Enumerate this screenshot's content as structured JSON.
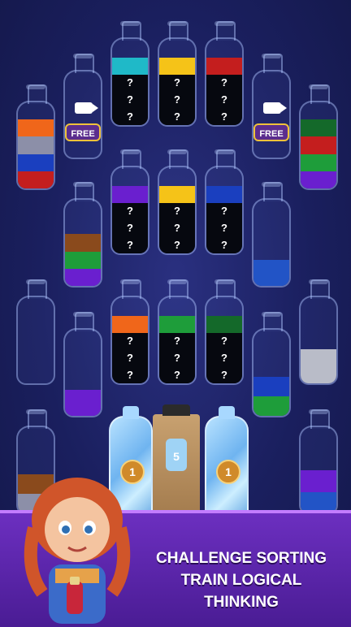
{
  "colors": {
    "cyan": "#1fb9c8",
    "yellow": "#f5c318",
    "red": "#c41e1e",
    "orange": "#f0661a",
    "gray": "#8c8fa8",
    "blue": "#1a3fbf",
    "green": "#1e9d3a",
    "dark_green": "#14692a",
    "purple": "#6a1fcf",
    "brown": "#8a4a1c",
    "light_gray": "#b9bcc8",
    "royal_blue": "#2254c6"
  },
  "bottles": [
    {
      "id": 1,
      "layers": [
        "orange",
        "gray",
        "blue",
        "red"
      ],
      "fill": 0.8
    },
    {
      "id": 2,
      "locked": true,
      "badge": "FREE",
      "icon": "video-camera-icon"
    },
    {
      "id": 3,
      "mystery": [
        "cyan"
      ],
      "unknown_count": 3
    },
    {
      "id": 4,
      "mystery": [
        "yellow"
      ],
      "unknown_count": 3
    },
    {
      "id": 5,
      "mystery": [
        "red"
      ],
      "unknown_count": 3
    },
    {
      "id": 6,
      "locked": true,
      "badge": "FREE",
      "icon": "video-camera-icon"
    },
    {
      "id": 7,
      "layers": [
        "dark_green",
        "red",
        "green",
        "purple"
      ],
      "fill": 0.8
    },
    {
      "id": 8,
      "layers": [
        "brown",
        "green",
        "purple"
      ],
      "fill": 0.6
    },
    {
      "id": 9,
      "mystery": [
        "purple"
      ],
      "unknown_count": 3
    },
    {
      "id": 10,
      "mystery": [
        "yellow"
      ],
      "unknown_count": 3
    },
    {
      "id": 11,
      "mystery": [
        "blue"
      ],
      "unknown_count": 3
    },
    {
      "id": 12,
      "layers": [
        "royal_blue"
      ],
      "fill": 0.3
    },
    {
      "id": 13,
      "layers": [],
      "fill": 0
    },
    {
      "id": 14,
      "layers": [
        "purple"
      ],
      "fill": 0.3
    },
    {
      "id": 15,
      "mystery": [
        "orange"
      ],
      "unknown_count": 3
    },
    {
      "id": 16,
      "mystery": [
        "green"
      ],
      "unknown_count": 3
    },
    {
      "id": 17,
      "mystery": [
        "dark_green"
      ],
      "unknown_count": 3
    },
    {
      "id": 18,
      "layers": [
        "blue",
        "green"
      ],
      "fill": 0.45
    },
    {
      "id": 19,
      "layers": [
        "light_gray"
      ],
      "fill": 0.4
    },
    {
      "id": 20,
      "layers": [
        "brown",
        "gray"
      ],
      "fill": 0.45
    },
    {
      "id": 21,
      "layers": [
        "purple",
        "royal_blue"
      ],
      "fill": 0.5
    }
  ],
  "booster_items": [
    {
      "name": "ice-bottle",
      "count": "1"
    },
    {
      "name": "paper-bag-bottle",
      "count": "5"
    },
    {
      "name": "ice-bottle",
      "count": "1"
    }
  ],
  "question_mark": "?",
  "banner": {
    "line1": "CHALLENGE SORTING",
    "line2": "TRAIN LOGICAL",
    "line3": "THINKING"
  }
}
